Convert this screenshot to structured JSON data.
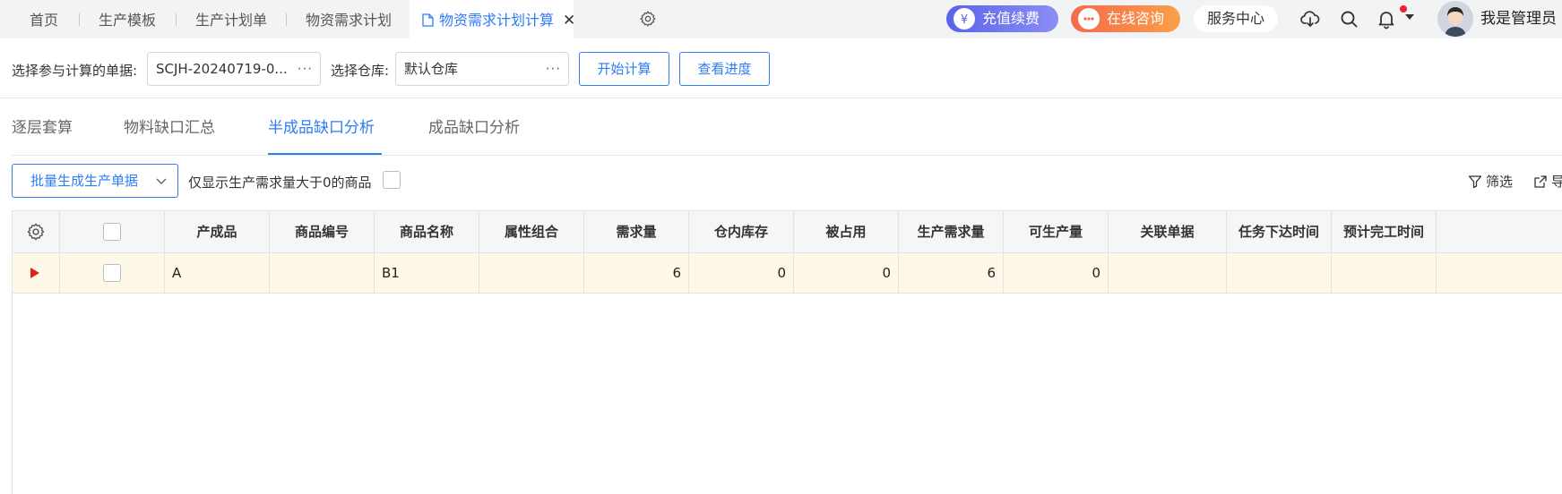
{
  "topbar": {
    "tabs": [
      "首页",
      "生产模板",
      "生产计划单",
      "物资需求计划"
    ],
    "active_tab": "物资需求计划计算",
    "close_glyph": "✕",
    "recharge": "充值续费",
    "consult": "在线咨询",
    "service": "服务中心",
    "username": "我是管理员",
    "icons": [
      "settings-icon",
      "cloud-download-icon",
      "search-icon",
      "bell-icon",
      "caret-down-icon",
      "avatar"
    ]
  },
  "form": {
    "doc_label": "选择参与计算的单据:",
    "doc_value": "SCJH-20240719-0...",
    "warehouse_label": "选择仓库:",
    "warehouse_value": "默认仓库",
    "dots": "···",
    "start_btn": "开始计算",
    "progress_btn": "查看进度"
  },
  "subtabs": {
    "items": [
      "逐层套算",
      "物料缺口汇总",
      "半成品缺口分析",
      "成品缺口分析"
    ],
    "active_index": 2
  },
  "toolbar": {
    "batch_btn": "批量生成生产单据",
    "only_positive": "仅显示生产需求量大于0的商品",
    "filter": "筛选",
    "export": "导"
  },
  "table": {
    "columns": [
      "产成品",
      "商品编号",
      "商品名称",
      "属性组合",
      "需求量",
      "仓内库存",
      "被占用",
      "生产需求量",
      "可生产量",
      "关联单据",
      "任务下达时间",
      "预计完工时间"
    ],
    "rows": [
      {
        "product": "A",
        "code": "",
        "name": "B1",
        "attrs": "",
        "demand": "6",
        "stock": "0",
        "occupied": "0",
        "prod_demand": "6",
        "producible": "0",
        "related": "",
        "issue_time": "",
        "finish_time": ""
      }
    ]
  },
  "colors": {
    "accent": "#2e7cf6",
    "row_highlight": "#fdf8e8",
    "marker": "#e02020"
  }
}
